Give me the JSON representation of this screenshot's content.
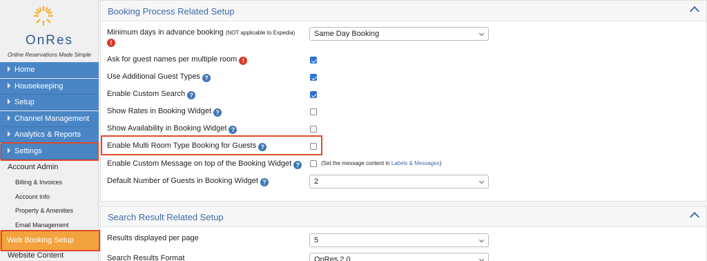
{
  "brand": {
    "name": "OnRes",
    "tagline": "Online Reservations Made Simple"
  },
  "sidebar": {
    "nav": [
      {
        "label": "Home"
      },
      {
        "label": "Housekeeping"
      },
      {
        "label": "Setup"
      },
      {
        "label": "Channel Management"
      },
      {
        "label": "Analytics & Reports"
      },
      {
        "label": "Settings"
      }
    ],
    "account_admin": "Account Admin",
    "sub_items": [
      {
        "label": "Billing & Invoices"
      },
      {
        "label": "Account Info"
      },
      {
        "label": "Property & Amenities"
      },
      {
        "label": "Email Management"
      }
    ],
    "active": "Web Booking Setup",
    "after_active": "Website Content"
  },
  "booking_panel": {
    "title": "Booking Process Related Setup",
    "min_days_label": "Minimum days in advance booking",
    "min_days_note": "(NOT applicable to Expedia)",
    "min_days_value": "Same Day Booking",
    "rows": [
      {
        "label": "Ask for guest names per multiple room",
        "checked": true
      },
      {
        "label": "Use Additional Guest Types",
        "checked": true
      },
      {
        "label": "Enable Custom Search",
        "checked": true
      },
      {
        "label": "Show Rates in Booking Widget",
        "checked": false
      },
      {
        "label": "Show Availability in Booking Widget",
        "checked": false
      },
      {
        "label": "Enable Multi Room Type Booking for Guests",
        "checked": false
      },
      {
        "label": "Enable Custom Message on top of the Booking Widget",
        "checked": false
      }
    ],
    "custom_message_note_prefix": "(Set the message content in",
    "custom_message_note_link": "Labels & Messages",
    "custom_message_note_suffix": ")",
    "guests_label": "Default Number of Guests in Booking Widget",
    "guests_value": "2"
  },
  "search_panel": {
    "title": "Search Result Related Setup",
    "results_label": "Results displayed per page",
    "results_value": "5",
    "format_label": "Search Results Format",
    "format_value": "OnRes 2.0"
  },
  "icons": {
    "help": "?",
    "warn": "!"
  },
  "colors": {
    "nav_blue": "#4a86c5",
    "active_orange": "#f3a33d",
    "highlight_red": "#e04a2c",
    "title_blue": "#3c6aa8"
  }
}
